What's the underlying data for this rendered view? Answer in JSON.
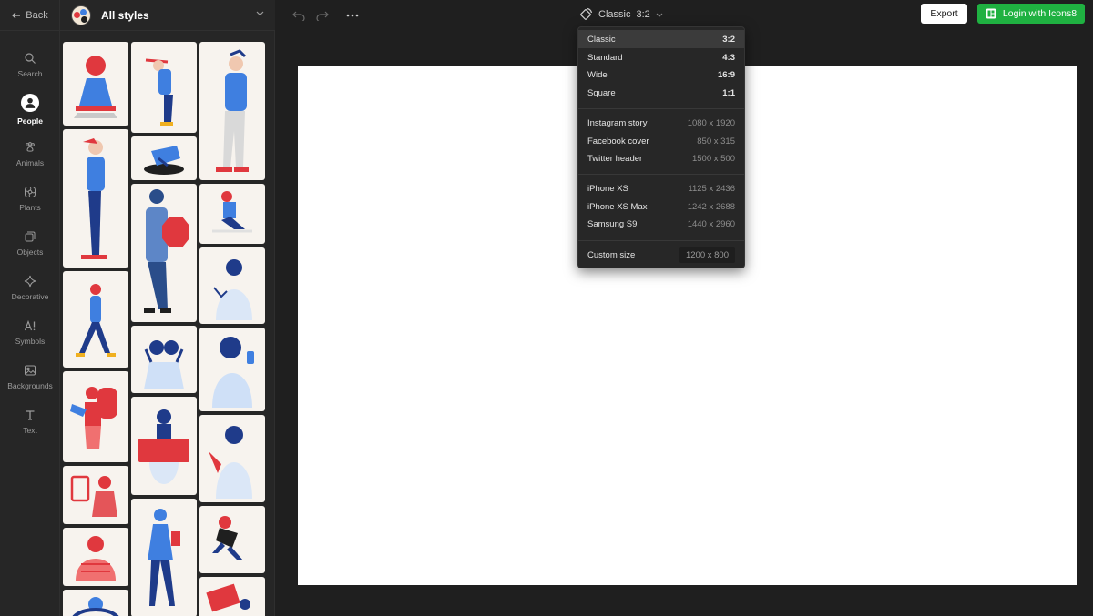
{
  "nav": {
    "back_label": "Back",
    "items": [
      {
        "label": "Search",
        "icon": "search-icon"
      },
      {
        "label": "People",
        "icon": "person-icon"
      },
      {
        "label": "Animals",
        "icon": "paw-icon"
      },
      {
        "label": "Plants",
        "icon": "flower-icon"
      },
      {
        "label": "Objects",
        "icon": "objects-icon"
      },
      {
        "label": "Decorative",
        "icon": "sparkle-icon"
      },
      {
        "label": "Symbols",
        "icon": "symbols-icon"
      },
      {
        "label": "Backgrounds",
        "icon": "image-icon"
      },
      {
        "label": "Text",
        "icon": "text-icon"
      }
    ],
    "active": "People"
  },
  "styles": {
    "title": "All styles"
  },
  "toolbar": {
    "ratio_name": "Classic",
    "ratio_value": "3:2",
    "export_label": "Export",
    "login_label": "Login with Icons8"
  },
  "dropdown": {
    "groups": [
      [
        {
          "label": "Classic",
          "value": "3:2",
          "selected": true
        },
        {
          "label": "Standard",
          "value": "4:3"
        },
        {
          "label": "Wide",
          "value": "16:9"
        },
        {
          "label": "Square",
          "value": "1:1"
        }
      ],
      [
        {
          "label": "Instagram story",
          "value": "1080 x 1920"
        },
        {
          "label": "Facebook cover",
          "value": "850 x 315"
        },
        {
          "label": "Twitter header",
          "value": "1500 x 500"
        }
      ],
      [
        {
          "label": "iPhone XS",
          "value": "1125 x 2436"
        },
        {
          "label": "iPhone XS Max",
          "value": "1242 x 2688"
        },
        {
          "label": "Samsung S9",
          "value": "1440 x 2960"
        }
      ]
    ],
    "custom": {
      "label": "Custom size",
      "value": "1200 x 800"
    }
  },
  "colors": {
    "accent_green": "#1fb141",
    "illustration_blue": "#3f7fe0",
    "illustration_red": "#e0383e",
    "illustration_navy": "#1f3b8a"
  }
}
